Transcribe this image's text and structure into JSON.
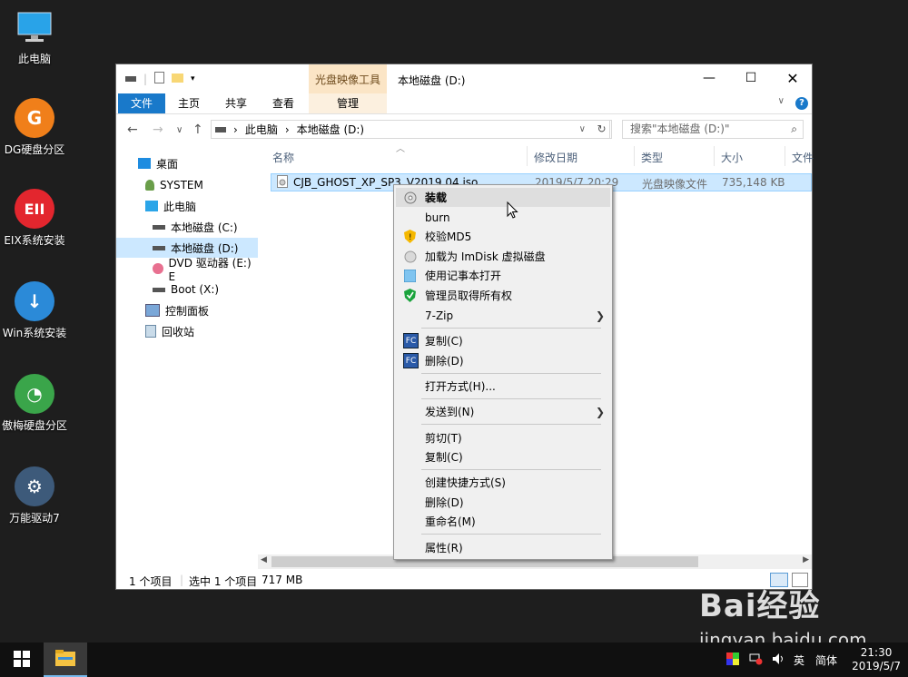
{
  "desktop": {
    "icons": [
      {
        "label": "此电脑",
        "icon": "monitor-icon",
        "color": "#29a3e8"
      },
      {
        "label": "DG硬盘分区",
        "icon": "dg-icon",
        "color": "#f07f1a",
        "glyph": "G"
      },
      {
        "label": "EIX系统安装",
        "icon": "eix-icon",
        "color": "#e3262e",
        "glyph": "EII"
      },
      {
        "label": "Win系统安装",
        "icon": "download-icon",
        "color": "#2b8ad8",
        "glyph": "↓"
      },
      {
        "label": "傲梅硬盘分区",
        "icon": "pie-icon",
        "color": "#3aa54a",
        "glyph": "◔"
      },
      {
        "label": "万能驱动7",
        "icon": "gear-icon",
        "color": "#3d5a7a",
        "glyph": "⚙"
      }
    ]
  },
  "window": {
    "tool_header": "光盘映像工具",
    "title": "本地磁盘 (D:)",
    "tabs": [
      "文件",
      "主页",
      "共享",
      "查看",
      "管理"
    ],
    "address": [
      "此电脑",
      "本地磁盘 (D:)"
    ],
    "search_placeholder": "搜索\"本地磁盘 (D:)\"",
    "nav": [
      {
        "label": "桌面",
        "icon": "desktop-icon"
      },
      {
        "label": "SYSTEM",
        "icon": "user-icon"
      },
      {
        "label": "此电脑",
        "icon": "pc-icon"
      },
      {
        "label": "本地磁盘 (C:)",
        "icon": "drive-icon"
      },
      {
        "label": "本地磁盘 (D:)",
        "icon": "drive-icon"
      },
      {
        "label": "DVD 驱动器 (E:) E",
        "icon": "dvd-icon"
      },
      {
        "label": "Boot (X:)",
        "icon": "drive-icon"
      },
      {
        "label": "控制面板",
        "icon": "control-panel-icon"
      },
      {
        "label": "回收站",
        "icon": "recycle-bin-icon"
      }
    ],
    "columns": [
      "名称",
      "修改日期",
      "类型",
      "大小",
      "文件"
    ],
    "file": {
      "name": "CJB_GHOST_XP_SP3_V2019.04.iso",
      "date": "2019/5/7 20:29",
      "type": "光盘映像文件",
      "size": "735,148 KB"
    },
    "status": {
      "count": "1 个项目",
      "selected": "选中 1 个项目",
      "size": "717 MB"
    }
  },
  "context_menu": {
    "items": [
      {
        "label": "装载",
        "icon": "disc-icon",
        "bold": true
      },
      {
        "label": "burn",
        "icon": ""
      },
      {
        "label": "校验MD5",
        "icon": "shield-warning-icon"
      },
      {
        "label": "加载为 ImDisk 虚拟磁盘",
        "icon": "disk-icon"
      },
      {
        "label": "使用记事本打开",
        "icon": "notepad-icon"
      },
      {
        "label": "管理员取得所有权",
        "icon": "shield-check-icon"
      },
      {
        "label": "7-Zip",
        "icon": ""
      },
      {
        "label": "复制(C)",
        "icon": "fc-icon"
      },
      {
        "label": "删除(D)",
        "icon": "fc-icon"
      },
      {
        "label": "打开方式(H)...",
        "icon": ""
      },
      {
        "label": "发送到(N)",
        "icon": ""
      },
      {
        "label": "剪切(T)",
        "icon": ""
      },
      {
        "label": "复制(C)",
        "icon": ""
      },
      {
        "label": "创建快捷方式(S)",
        "icon": ""
      },
      {
        "label": "删除(D)",
        "icon": ""
      },
      {
        "label": "重命名(M)",
        "icon": ""
      },
      {
        "label": "属性(R)",
        "icon": ""
      }
    ]
  },
  "taskbar": {
    "ime": "英",
    "ime_mode": "简体",
    "time": "21:30",
    "date": "2019/5/7"
  },
  "watermark": {
    "brand": "Bai经验",
    "url": "jingyan.baidu.com"
  }
}
